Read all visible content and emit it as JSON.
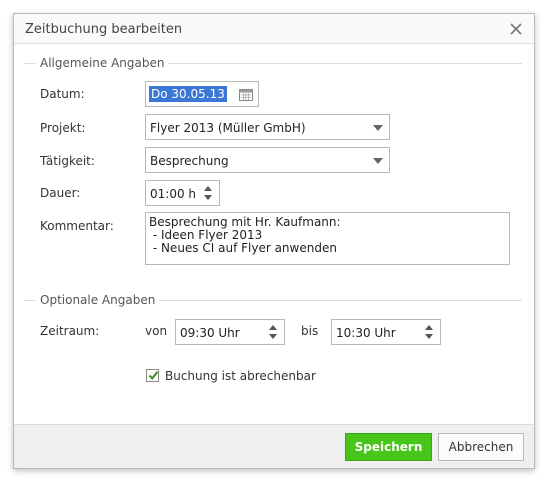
{
  "dialog": {
    "title": "Zeitbuchung bearbeiten"
  },
  "general": {
    "legend": "Allgemeine Angaben",
    "date_label": "Datum:",
    "date_value": "Do 30.05.13",
    "project_label": "Projekt:",
    "project_value": "Flyer 2013 (Müller GmbH)",
    "activity_label": "Tätigkeit:",
    "activity_value": "Besprechung",
    "duration_label": "Dauer:",
    "duration_value": "01:00 h",
    "comment_label": "Kommentar:",
    "comment_lines": [
      "Besprechung mit Hr. Kaufmann:",
      " - Ideen Flyer 2013",
      " - Neues CI auf Flyer anwenden"
    ]
  },
  "optional": {
    "legend": "Optionale Angaben",
    "period_label": "Zeitraum:",
    "from_label": "von",
    "from_value": "09:30 Uhr",
    "to_label": "bis",
    "to_value": "10:30 Uhr",
    "billable_label": "Buchung ist abrechenbar",
    "billable_checked": true
  },
  "footer": {
    "save_label": "Speichern",
    "cancel_label": "Abbrechen"
  },
  "colors": {
    "save_button": "#47c518",
    "selection": "#3b78d6",
    "checkmark": "#2f8f16"
  }
}
